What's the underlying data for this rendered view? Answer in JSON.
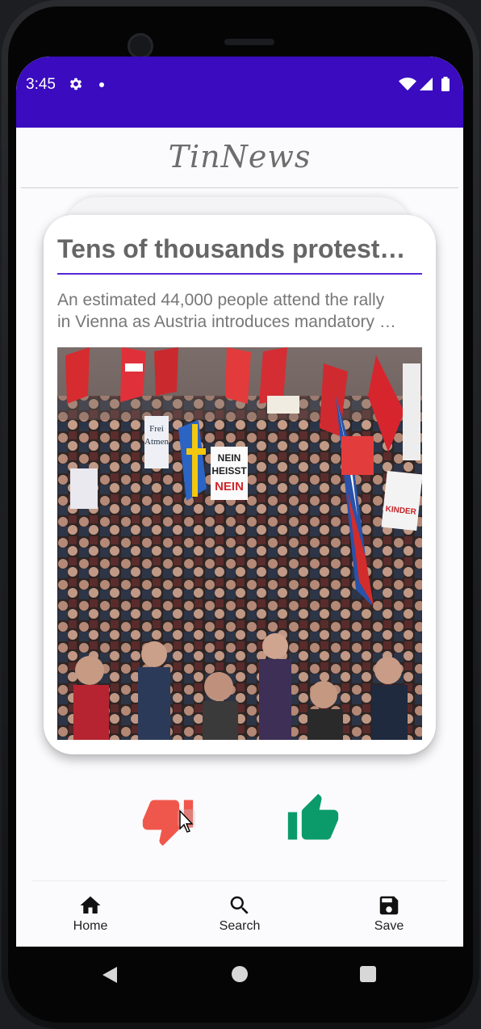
{
  "status": {
    "time": "3:45",
    "icons": [
      "gear-icon",
      "notification-dot",
      "wifi-icon",
      "signal-icon",
      "battery-icon"
    ]
  },
  "app": {
    "title": "TinNews"
  },
  "card": {
    "title": "Tens of thousands protest…",
    "description_line1": "An estimated 44,000 people attend the rally",
    "description_line2": "in Vienna as Austria introduces mandatory …",
    "image_alt": "Crowd of protesters with flags and signs",
    "sign_text_1": "NEIN",
    "sign_text_2": "HEISST",
    "sign_text_3": "NEIN",
    "sign_text_4": "Frei",
    "sign_text_5": "Atmen",
    "sign_text_6": "KINDER"
  },
  "actions": {
    "dislike_color": "#f0574c",
    "like_color": "#0b9b6a"
  },
  "nav": {
    "home_label": "Home",
    "search_label": "Search",
    "save_label": "Save"
  },
  "colors": {
    "statusbar": "#3a0bbf",
    "accent_rule": "#5727d6"
  }
}
